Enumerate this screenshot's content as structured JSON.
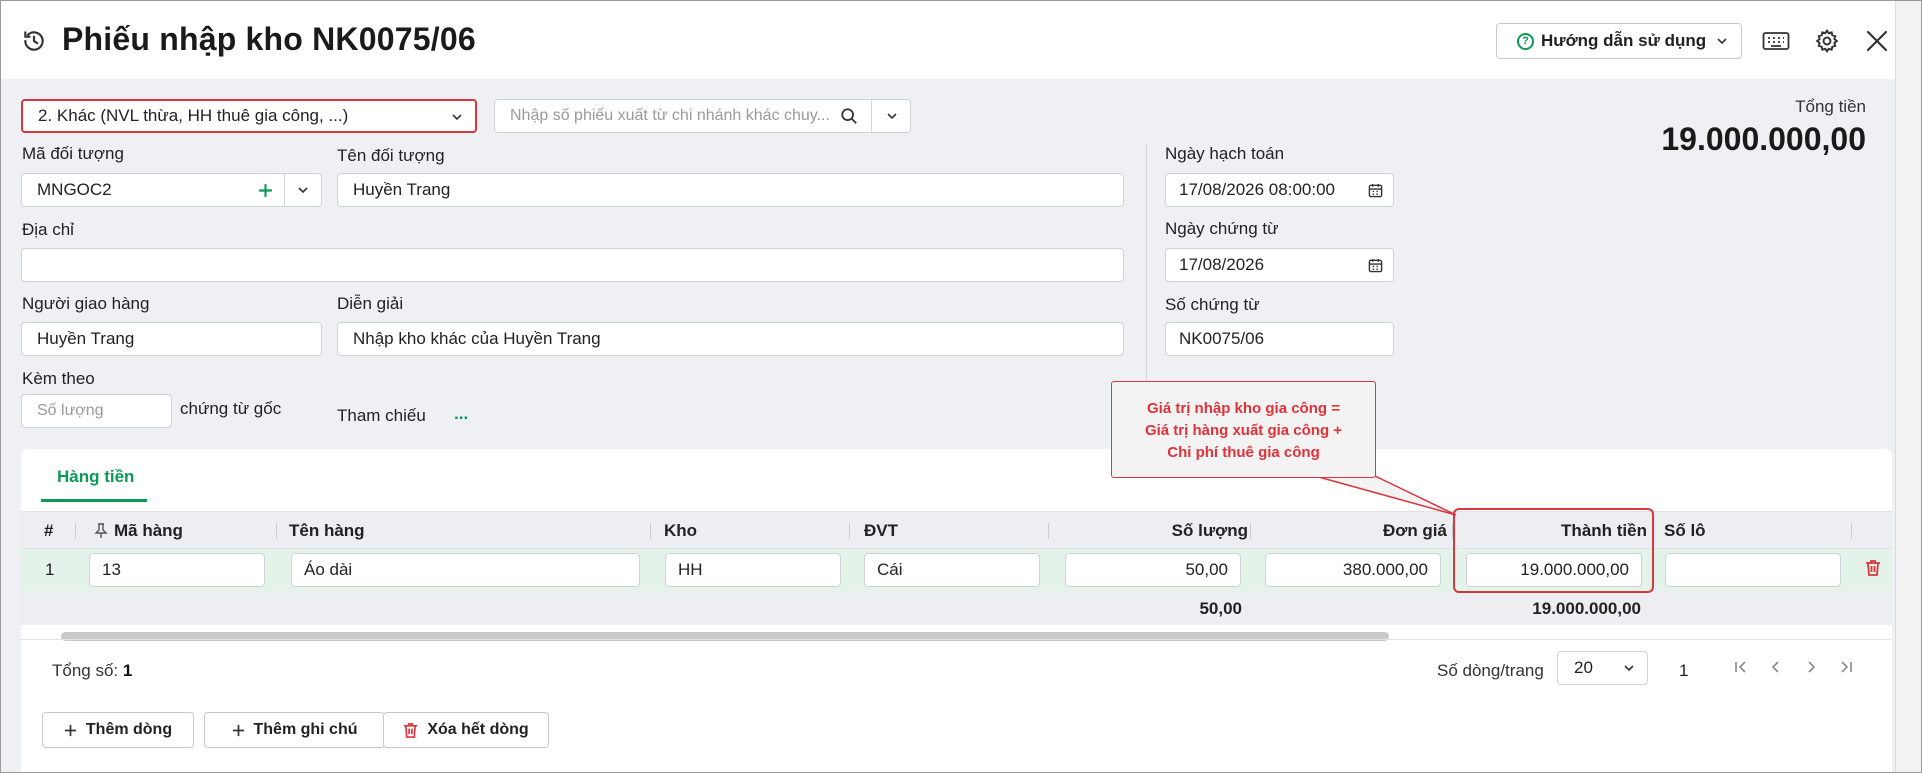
{
  "header": {
    "title": "Phiếu nhập kho NK0075/06",
    "help_label": "Hướng dẫn sử dụng"
  },
  "form": {
    "type_select": "2. Khác (NVL thừa, HH thuê gia công, ...)",
    "transfer_placeholder": "Nhập số phiếu xuất từ chi nhánh khác chuy...",
    "object_code_label": "Mã đối tượng",
    "object_code": "MNGOC2",
    "object_name_label": "Tên đối tượng",
    "object_name": "Huyền Trang",
    "address_label": "Địa chỉ",
    "address": "",
    "deliverer_label": "Người giao hàng",
    "deliverer": "Huyền Trang",
    "description_label": "Diễn giải",
    "description": "Nhập kho khác của Huyền Trang",
    "attach_label": "Kèm theo",
    "attach_placeholder": "Số lượng",
    "attach_suffix": "chứng từ gốc",
    "reference_label": "Tham chiếu",
    "reference_dots": "...",
    "posting_date_label": "Ngày hạch toán",
    "posting_date": "17/08/2026 08:00:00",
    "voucher_date_label": "Ngày chứng từ",
    "voucher_date": "17/08/2026",
    "voucher_no_label": "Số chứng từ",
    "voucher_no": "NK0075/06",
    "total_label": "Tổng tiền",
    "total_value": "19.000.000,00"
  },
  "callout": {
    "line1": "Giá trị nhập kho gia công =",
    "line2": "Giá trị hàng xuất gia công +",
    "line3": "Chi phí thuê gia công"
  },
  "tabs": {
    "goods": "Hàng tiền"
  },
  "table": {
    "columns": {
      "index": "#",
      "code": "Mã hàng",
      "name": "Tên hàng",
      "warehouse": "Kho",
      "unit": "ĐVT",
      "quantity": "Số lượng",
      "unit_price": "Đơn giá",
      "amount": "Thành tiền",
      "lot": "Số lô"
    },
    "rows": [
      {
        "index": "1",
        "code": "13",
        "name": "Áo dài",
        "warehouse": "HH",
        "unit": "Cái",
        "quantity": "50,00",
        "unit_price": "380.000,00",
        "amount": "19.000.000,00",
        "lot": ""
      }
    ],
    "totals": {
      "quantity": "50,00",
      "amount": "19.000.000,00"
    }
  },
  "footer": {
    "count_label": "Tổng số:",
    "count_value": "1",
    "rows_per_page_label": "Số dòng/trang",
    "rows_per_page": "20",
    "page": "1",
    "add_row": "Thêm dòng",
    "add_note": "Thêm ghi chú",
    "delete_all": "Xóa hết dòng"
  },
  "colors": {
    "accent_green": "#0a9a55",
    "highlight_red": "#d9363e",
    "row_selected": "#e3f3ea"
  }
}
